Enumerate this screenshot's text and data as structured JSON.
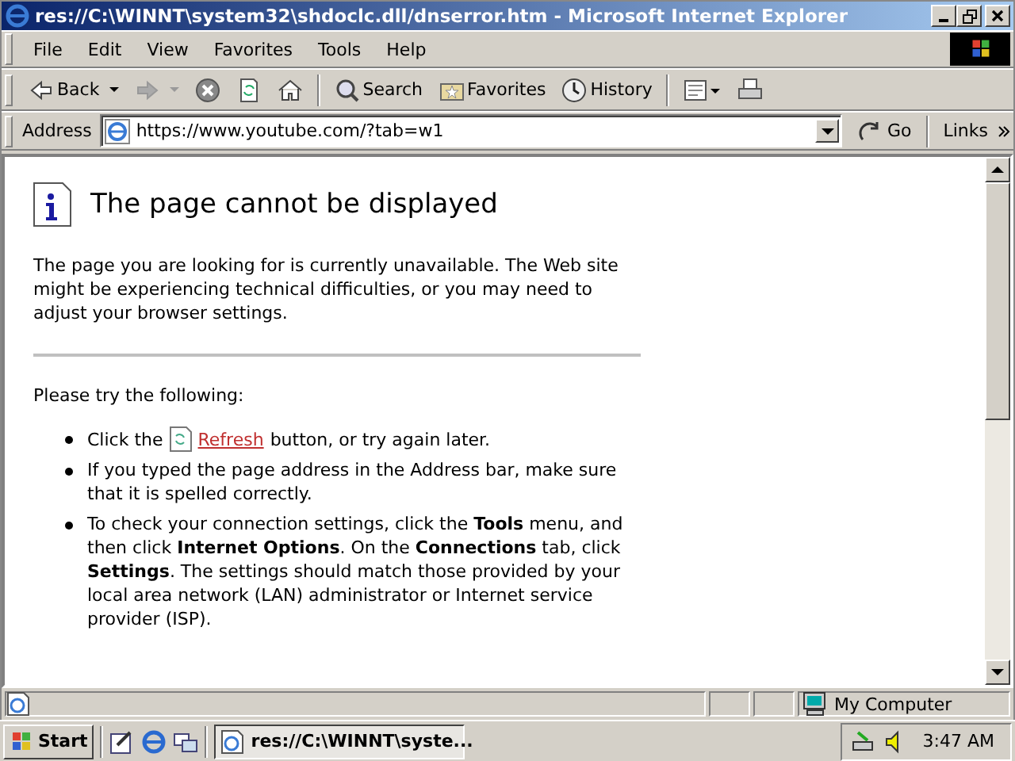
{
  "window": {
    "title": "res://C:\\WINNT\\system32\\shdoclc.dll/dnserror.htm - Microsoft Internet Explorer"
  },
  "menu": [
    "File",
    "Edit",
    "View",
    "Favorites",
    "Tools",
    "Help"
  ],
  "toolbar": [
    {
      "kind": "back",
      "label": "Back"
    },
    {
      "kind": "forward"
    },
    {
      "kind": "stop"
    },
    {
      "kind": "refresh"
    },
    {
      "kind": "home"
    },
    {
      "kind": "search",
      "label": "Search"
    },
    {
      "kind": "favorites",
      "label": "Favorites"
    },
    {
      "kind": "history",
      "label": "History"
    },
    {
      "kind": "mail"
    },
    {
      "kind": "print"
    }
  ],
  "address": {
    "label": "Address",
    "value": "https://www.youtube.com/?tab=w1",
    "go": "Go",
    "links": "Links"
  },
  "page": {
    "heading": "The page cannot be displayed",
    "intro": "The page you are looking for is currently unavailable. The Web site might be experiencing technical difficulties, or you may need to adjust your browser settings.",
    "try_label": "Please try the following:",
    "items": [
      {
        "kind": "refresh",
        "before": "Click the",
        "link": "Refresh",
        "after": "button, or try again later."
      },
      {
        "kind": "text",
        "text": "If you typed the page address in the Address bar, make sure that it is spelled correctly."
      },
      {
        "kind": "text",
        "text": "To check your connection settings, click the **Tools** menu, and then click **Internet Options**. On the **Connections** tab, click **Settings**. The settings should match those provided by your local area network (LAN) administrator or Internet service provider (ISP)."
      }
    ]
  },
  "status_bar": {
    "zone": "My Computer"
  },
  "taskbar": {
    "start": "Start",
    "tasks": [
      {
        "label": "res://C:\\WINNT\\syste...",
        "selected": true
      }
    ],
    "clock": "3:47 AM"
  }
}
